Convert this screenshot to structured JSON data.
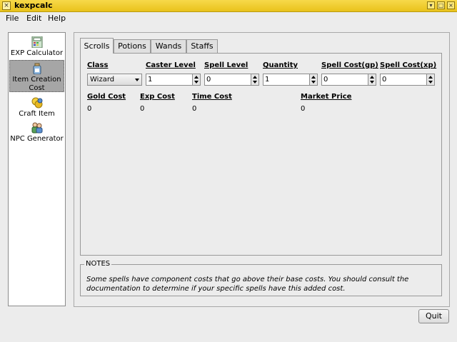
{
  "window": {
    "title": "kexpcalc",
    "icon": "calculator-icon"
  },
  "menu": [
    "File",
    "Edit",
    "Help"
  ],
  "sidebar": {
    "items": [
      {
        "label": "EXP Calculator",
        "icon": "calculator-icon"
      },
      {
        "label": "Item Creation Cost",
        "icon": "jar-icon"
      },
      {
        "label": "Craft Item",
        "icon": "coins-icon"
      },
      {
        "label": "NPC Generator",
        "icon": "people-icon"
      }
    ],
    "selected": "Item Creation Cost"
  },
  "tabs": [
    "Scrolls",
    "Potions",
    "Wands",
    "Staffs"
  ],
  "active_tab": "Scrolls",
  "form": {
    "class_label": "Class",
    "class_value": "Wizard",
    "caster_level_label": "Caster Level",
    "caster_level_value": "1",
    "spell_level_label": "Spell Level",
    "spell_level_value": "0",
    "quantity_label": "Quantity",
    "quantity_value": "1",
    "spell_cost_gp_label": "Spell Cost(gp)",
    "spell_cost_gp_value": "0",
    "spell_cost_xp_label": "Spell Cost(xp)",
    "spell_cost_xp_value": "0"
  },
  "results": {
    "gold_cost_label": "Gold Cost",
    "gold_cost_value": "0",
    "exp_cost_label": "Exp Cost",
    "exp_cost_value": "0",
    "time_cost_label": "Time Cost",
    "time_cost_value": "0",
    "market_price_label": "Market Price",
    "market_price_value": "0"
  },
  "notes": {
    "legend": "NOTES",
    "text": "Some spells have component costs that go above their base costs. You should consult the documentation to determine if your specific spells have this added cost."
  },
  "quit_label": "Quit"
}
